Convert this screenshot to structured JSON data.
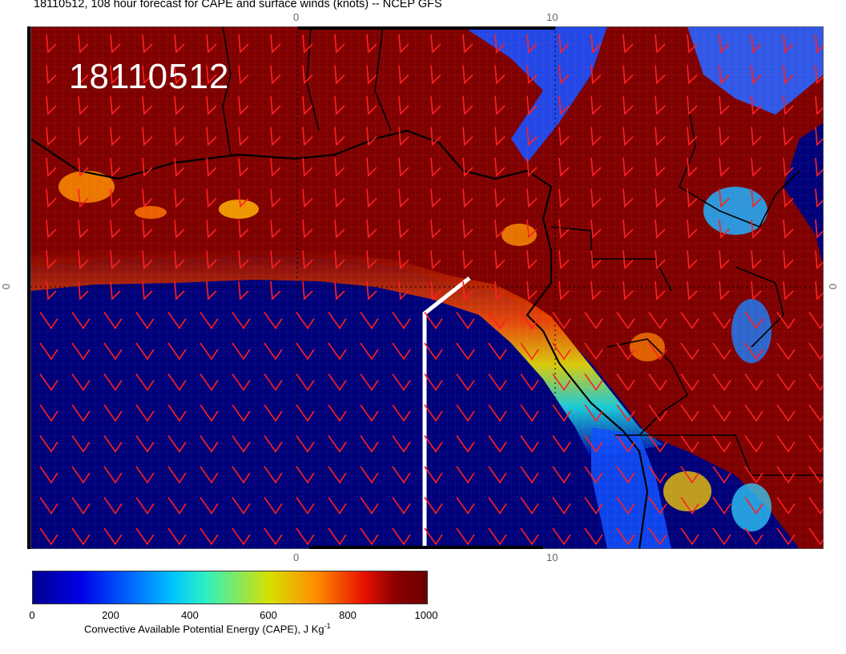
{
  "title": "18110512, 108 hour forecast for CAPE and surface winds (knots) -- NCEP GFS",
  "stamp": "18110512",
  "axis": {
    "lon_top": [
      "0",
      "10"
    ],
    "lon_bottom": [
      "0",
      "10"
    ],
    "lat_left": "0",
    "lat_right": "0"
  },
  "colorbar": {
    "ticks": [
      "0",
      "200",
      "400",
      "600",
      "800",
      "1000"
    ],
    "label": "Convective Available Potential Energy (CAPE), J Kg",
    "label_sup": "-1"
  },
  "colors": {
    "cape_high": "#800000",
    "cape_low": "#00007a",
    "wind_barbs": "#ff2020",
    "coastline": "#000000",
    "track": "#ffffff"
  }
}
